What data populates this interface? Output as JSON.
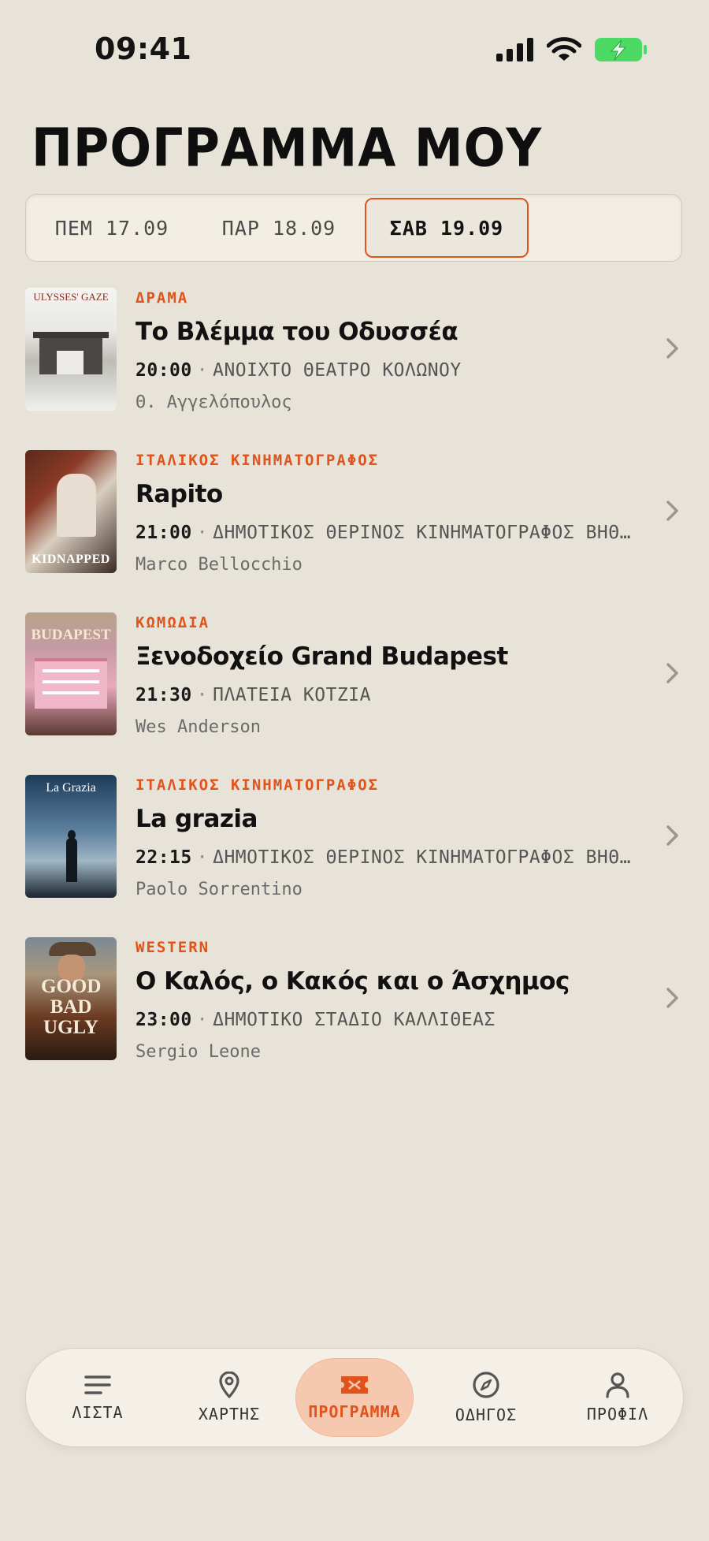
{
  "status_bar": {
    "time": "09:41"
  },
  "page_title": "ΠΡΟΓΡΑΜΜΑ ΜΟΥ",
  "days": [
    {
      "label": "ΠΕΜ 17.09",
      "selected": false
    },
    {
      "label": "ΠΑΡ 18.09",
      "selected": false
    },
    {
      "label": "ΣΑΒ 19.09",
      "selected": true
    }
  ],
  "films": [
    {
      "genre": "ΔΡΑΜΑ",
      "title": "Το Βλέμμα του Οδυσσέα",
      "time": "20:00",
      "venue": "ΑΝΟΙΧΤΟ ΘΕΑΤΡΟ ΚΟΛΩΝΟΥ",
      "director": "Θ. Αγγελόπουλος",
      "poster_text": "ULYSSES' GAZE"
    },
    {
      "genre": "ΙΤΑΛΙΚΟΣ ΚΙΝΗΜΑΤΟΓΡΑΦΟΣ",
      "title": "Rapito",
      "time": "21:00",
      "venue": "ΔΗΜΟΤΙΚΟΣ ΘΕΡΙΝΟΣ ΚΙΝΗΜΑΤΟΓΡΑΦΟΣ ΒΗΘΛΕΕΜ",
      "director": "Marco Bellocchio",
      "poster_text": "KIDNAPPED"
    },
    {
      "genre": "ΚΩΜΩΔΙΑ",
      "title": "Ξενοδοχείο Grand Budapest",
      "time": "21:30",
      "venue": "ΠΛΑΤΕΙΑ ΚΟΤΖΙΑ",
      "director": "Wes Anderson",
      "poster_text": "BUDAPEST"
    },
    {
      "genre": "ΙΤΑΛΙΚΟΣ ΚΙΝΗΜΑΤΟΓΡΑΦΟΣ",
      "title": "La grazia",
      "time": "22:15",
      "venue": "ΔΗΜΟΤΙΚΟΣ ΘΕΡΙΝΟΣ ΚΙΝΗΜΑΤΟΓΡΑΦΟΣ ΒΗΘΛΕΕΜ",
      "director": "Paolo Sorrentino",
      "poster_text": "La Grazia"
    },
    {
      "genre": "WESTERN",
      "title": "Ο Καλός, ο Κακός και ο Άσχημος",
      "time": "23:00",
      "venue": "ΔΗΜΟΤΙΚΟ ΣΤΑΔΙΟ ΚΑΛΛΙΘΕΑΣ",
      "director": "Sergio Leone",
      "poster_text": "GOOD BAD UGLY"
    }
  ],
  "nav": [
    {
      "label": "ΛΙΣΤΑ",
      "icon": "list-icon",
      "active": false
    },
    {
      "label": "ΧΑΡΤΗΣ",
      "icon": "map-pin-icon",
      "active": false
    },
    {
      "label": "ΠΡΟΓΡΑΜΜΑ",
      "icon": "ticket-icon",
      "active": true
    },
    {
      "label": "ΟΔΗΓΟΣ",
      "icon": "compass-icon",
      "active": false
    },
    {
      "label": "ΠΡΟΦΙΛ",
      "icon": "user-icon",
      "active": false
    }
  ],
  "colors": {
    "accent": "#e0531a",
    "background": "#e8e3d8",
    "battery": "#4cd964"
  }
}
